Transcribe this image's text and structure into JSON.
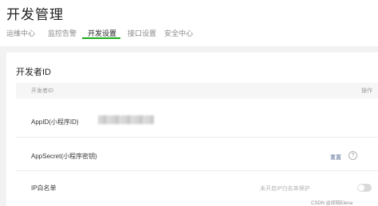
{
  "header": {
    "title": "开发管理",
    "tabs": [
      {
        "label": "运维中心"
      },
      {
        "label": "监控告警"
      },
      {
        "label": "开发设置"
      },
      {
        "label": "接口设置"
      },
      {
        "label": "安全中心"
      }
    ],
    "active_tab": "开发设置"
  },
  "developer_id": {
    "section_title": "开发者ID",
    "columns": {
      "left": "开发者ID",
      "right": "操作"
    },
    "rows": [
      {
        "label": "AppID(小程序ID)"
      },
      {
        "label": "AppSecret(小程序密钥)",
        "action": "重置"
      },
      {
        "label": "IP白名单",
        "hint": "未开启IP白名单保护",
        "toggle_on": false
      }
    ]
  },
  "watermark": "CSDN @邱晓Elena",
  "colors": {
    "accent": "#1aad19",
    "link": "#576b95"
  },
  "icons": {
    "help": "question-circle-icon"
  }
}
